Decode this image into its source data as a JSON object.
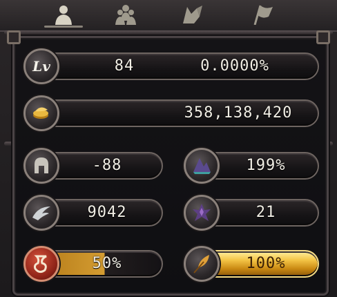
{
  "tabs": [
    {
      "name": "character",
      "icon": "person-icon",
      "active": true
    },
    {
      "name": "party",
      "icon": "group-icon",
      "active": false
    },
    {
      "name": "pet",
      "icon": "fox-icon",
      "active": false
    },
    {
      "name": "guild",
      "icon": "flag-icon",
      "active": false
    }
  ],
  "level": {
    "icon_text": "Lv",
    "value": "84",
    "exp_percent": "0.0000%"
  },
  "gold": {
    "icon": "coins-icon",
    "value": "358,138,420"
  },
  "stats": {
    "defense": {
      "icon": "helmet-icon",
      "value": "-88"
    },
    "magic": {
      "icon": "crystal-icon",
      "value": "199%"
    },
    "speed": {
      "icon": "wing-icon",
      "value": "9042"
    },
    "crit": {
      "icon": "star-crystal-icon",
      "value": "21"
    },
    "hunger": {
      "icon": "stomach-icon",
      "value": "50%",
      "fill": 0.5
    },
    "stamina": {
      "icon": "feather-icon",
      "value": "100%",
      "fill": 1.0
    }
  },
  "colors": {
    "gold_fill": "#f3c446",
    "red_badge": "#8e2317",
    "text": "#f2efe6"
  }
}
